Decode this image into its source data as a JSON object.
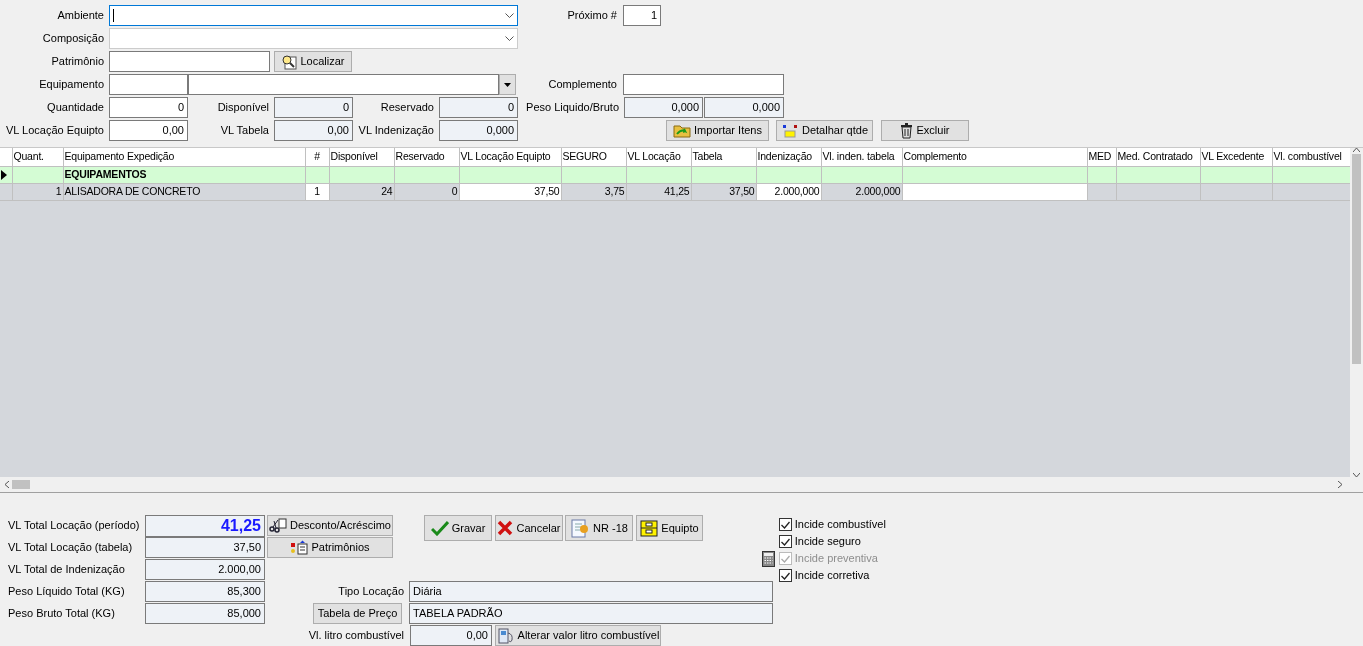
{
  "ambiente": {
    "label": "Ambiente",
    "focused": true
  },
  "proximo": {
    "label": "Próximo #",
    "value": "1"
  },
  "composicao": {
    "label": "Composição",
    "disabled": true
  },
  "patrimonio": {
    "label": "Patrimônio",
    "button": "Localizar"
  },
  "equipamento": {
    "label": "Equipamento"
  },
  "complemento": {
    "label": "Complemento"
  },
  "quantidade": {
    "label": "Quantidade",
    "value": "0"
  },
  "disponivel": {
    "label": "Disponível",
    "value": "0",
    "readonly": true
  },
  "reservado": {
    "label": "Reservado",
    "value": "0",
    "readonly": true
  },
  "peso": {
    "label": "Peso Liquido/Bruto",
    "values": [
      "0,000",
      "0,000"
    ],
    "readonly": true
  },
  "vl_locacao": {
    "label": "VL Locação Equipto",
    "value": "0,00"
  },
  "vl_tabela": {
    "label": "VL Tabela",
    "value": "0,00",
    "readonly": true
  },
  "vl_indenizacao": {
    "label": "VL Indenização",
    "value": "0,000",
    "readonly": true
  },
  "actions": [
    "Importar Itens",
    "Detalhar qtde",
    "Excluir"
  ],
  "grid": {
    "columns": [
      {
        "label": "Quant.",
        "editable": false
      },
      {
        "label": "Equipamento Expedição",
        "editable": false
      },
      {
        "label": "#",
        "editable": true
      },
      {
        "label": "Disponível",
        "editable": false
      },
      {
        "label": "Reservado",
        "editable": false
      },
      {
        "label": "VL Locação Equipto",
        "editable": true
      },
      {
        "label": "SEGURO",
        "editable": false
      },
      {
        "label": "VL Locação",
        "editable": false
      },
      {
        "label": "Tabela",
        "editable": false
      },
      {
        "label": "Indenização",
        "editable": true
      },
      {
        "label": "Vl. inden. tabela",
        "editable": false
      },
      {
        "label": "Complemento",
        "editable": true
      },
      {
        "label": "MED",
        "editable": false
      },
      {
        "label": "Med. Contratado",
        "editable": false
      },
      {
        "label": "VL Excedente",
        "editable": false
      },
      {
        "label": "Vl. combustível",
        "editable": false
      }
    ],
    "rows": [
      {
        "kind": "group",
        "label": "EQUIPAMENTOS",
        "current": true
      },
      {
        "kind": "item",
        "current": false,
        "cells": [
          "1",
          "ALISADORA DE CONCRETO",
          "1",
          "24",
          "0",
          "37,50",
          "3,75",
          "41,25",
          "37,50",
          "2.000,000",
          "2.000,000"
        ]
      }
    ]
  },
  "totals": [
    {
      "label": "VL Total Locação (período)",
      "value": "41,25",
      "emphasis": true
    },
    {
      "label": "VL Total Locação (tabela)",
      "value": "37,50",
      "emphasis": false
    },
    {
      "label": "VL Total de Indenização",
      "value": "2.000,00",
      "emphasis": false
    },
    {
      "label": "Peso Líquido Total (KG)",
      "value": "85,300",
      "emphasis": false
    },
    {
      "label": "Peso Bruto Total (KG)",
      "value": "85,000",
      "emphasis": false
    }
  ],
  "side_buttons": [
    "Desconto/Acréscimo",
    "Patrimônios"
  ],
  "main_buttons": [
    "Gravar",
    "Cancelar",
    "NR -18",
    "Equipto"
  ],
  "tipo_locacao": {
    "label": "Tipo Locação",
    "value": "Diária"
  },
  "tabela_preco": {
    "button": "Tabela de Preço",
    "value": "TABELA PADRÃO"
  },
  "combustivel": {
    "label": "Vl. litro combustível",
    "value": "0,00",
    "button": "Alterar valor litro combustível"
  },
  "options": [
    {
      "label": "Incide combustível",
      "checked": true,
      "disabled": false
    },
    {
      "label": "Incide seguro",
      "checked": true,
      "disabled": false
    },
    {
      "label": "Incide preventiva",
      "checked": true,
      "disabled": true
    },
    {
      "label": "Incide corretiva",
      "checked": true,
      "disabled": false
    }
  ]
}
